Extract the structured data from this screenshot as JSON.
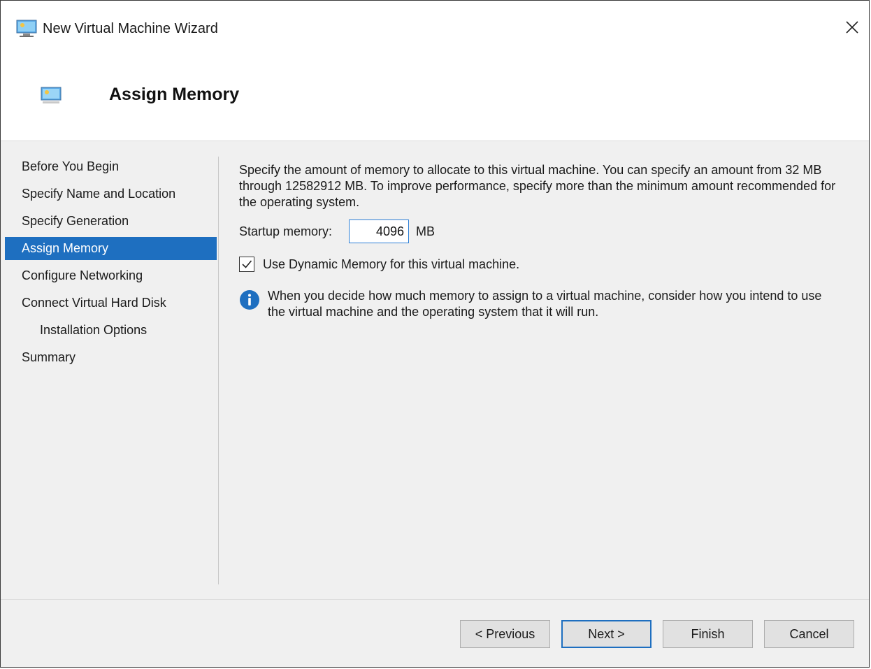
{
  "window": {
    "title": "New Virtual Machine Wizard",
    "close_symbol": "✕"
  },
  "header": {
    "title": "Assign Memory"
  },
  "nav": {
    "items": [
      {
        "label": "Before You Begin",
        "active": false,
        "indent": false
      },
      {
        "label": "Specify Name and Location",
        "active": false,
        "indent": false
      },
      {
        "label": "Specify Generation",
        "active": false,
        "indent": false
      },
      {
        "label": "Assign Memory",
        "active": true,
        "indent": false
      },
      {
        "label": "Configure Networking",
        "active": false,
        "indent": false
      },
      {
        "label": "Connect Virtual Hard Disk",
        "active": false,
        "indent": false
      },
      {
        "label": "Installation Options",
        "active": false,
        "indent": true
      },
      {
        "label": "Summary",
        "active": false,
        "indent": false
      }
    ]
  },
  "content": {
    "description": "Specify the amount of memory to allocate to this virtual machine. You can specify an amount from 32 MB through 12582912 MB. To improve performance, specify more than the minimum amount recommended for the operating system.",
    "startup_memory_label": "Startup memory:",
    "startup_memory_value": "4096",
    "startup_memory_unit": "MB",
    "dynamic_memory_label": "Use Dynamic Memory for this virtual machine.",
    "dynamic_memory_checked": true,
    "info_text": "When you decide how much memory to assign to a virtual machine, consider how you intend to use the virtual machine and the operating system that it will run."
  },
  "footer": {
    "previous_label": "< Previous",
    "next_label": "Next >",
    "finish_label": "Finish",
    "cancel_label": "Cancel"
  },
  "icons": {
    "app": "virtual-machine-icon",
    "info": "info-icon",
    "close": "close-icon"
  },
  "colors": {
    "accent": "#1e6fc0",
    "panel": "#f0f0f0",
    "info": "#1e6fc0"
  }
}
